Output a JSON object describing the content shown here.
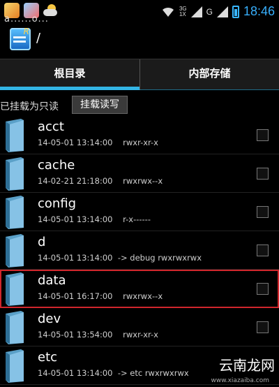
{
  "status_bar": {
    "time": "18:46",
    "network": "3G",
    "sim": "1X",
    "carrier_letter": "G",
    "accent": "#37aefb"
  },
  "top_garble": "a......o...",
  "title_bar": {
    "path": "/"
  },
  "tabs": [
    {
      "label": "根目录",
      "active": true
    },
    {
      "label": "内部存储",
      "active": false
    }
  ],
  "mount_bar": {
    "status": "已挂载为只读",
    "button": "挂载读写"
  },
  "files": [
    {
      "name": "acct",
      "date": "14-05-01 13:14:00",
      "perms": "rwxr-xr-x"
    },
    {
      "name": "cache",
      "date": "14-02-21 21:18:00",
      "perms": "rwxrwx--x"
    },
    {
      "name": "config",
      "date": "14-05-01 13:14:00",
      "perms": "r-x------"
    },
    {
      "name": "d",
      "date": "14-05-01 13:14:00",
      "perms": "-> debug  rwxrwxrwx"
    },
    {
      "name": "data",
      "date": "14-05-01 16:17:00",
      "perms": "rwxrwx--x",
      "selected": true
    },
    {
      "name": "dev",
      "date": "14-05-01 13:54:00",
      "perms": "rwxr-xr-x"
    },
    {
      "name": "etc",
      "date": "14-05-01 13:14:00",
      "perms": "-> etc  rwxrwxrwx"
    }
  ],
  "watermark": {
    "text": "云南龙网",
    "url": "www.xiazaiba.com"
  },
  "colors": {
    "tab_accent": "#33b5e5",
    "selection": "#d0262c"
  }
}
